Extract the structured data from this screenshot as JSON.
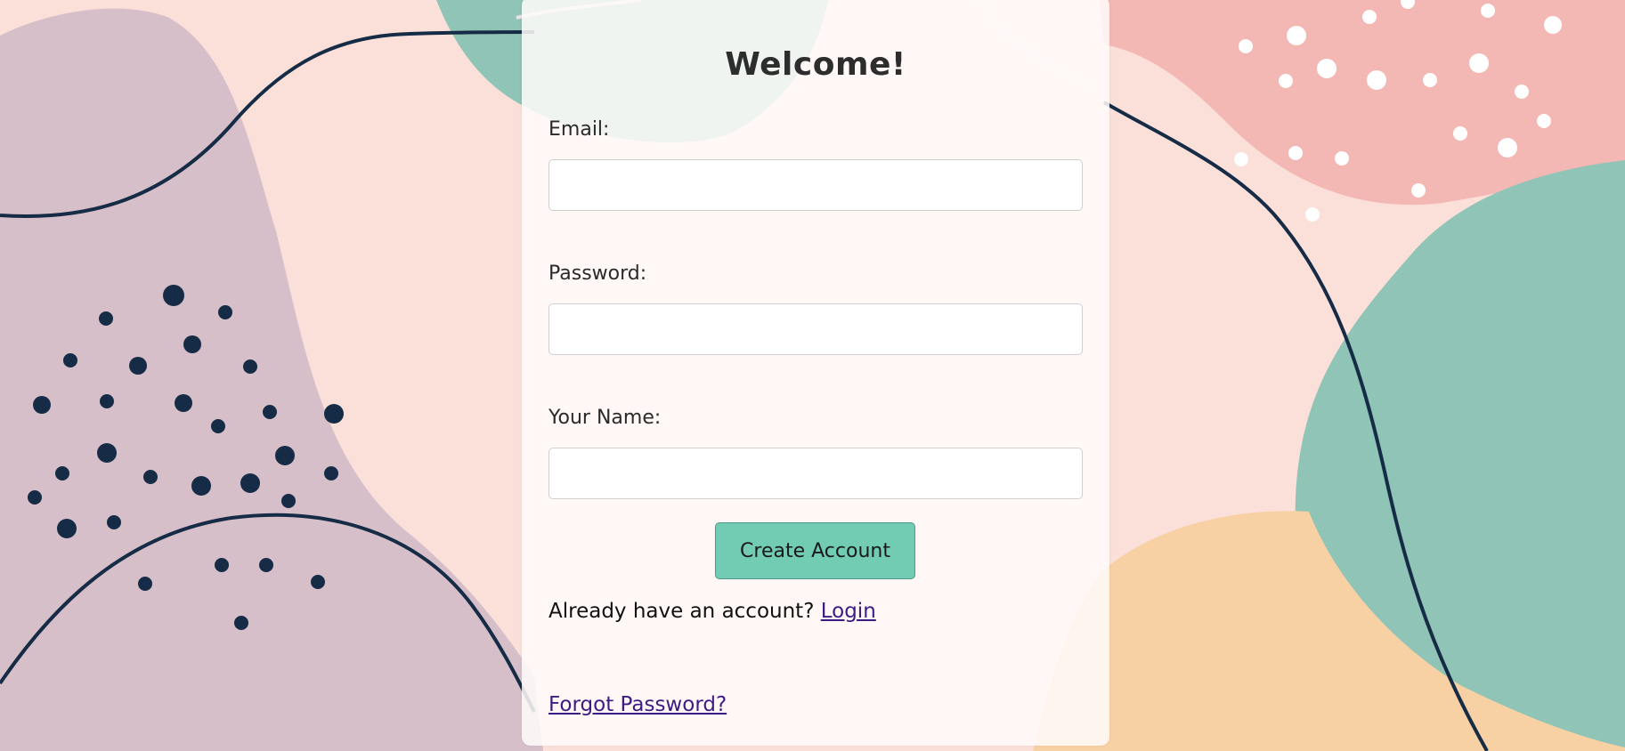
{
  "page": {
    "heading": "Welcome!"
  },
  "form": {
    "email_label": "Email:",
    "email_value": "",
    "password_label": "Password:",
    "password_value": "",
    "name_label": "Your Name:",
    "name_value": "",
    "submit_label": "Create Account"
  },
  "footer": {
    "login_prompt": "Already have an account?",
    "login_link": "Login",
    "forgot_link": "Forgot Password?"
  },
  "colors": {
    "background_peach": "#fbe0d9",
    "blob_mauve": "#d6bfc9",
    "blob_teal": "#8fc4b6",
    "blob_pink": "#f3b8b4",
    "blob_orange": "#f7d1a4",
    "dots_navy": "#162c46",
    "button_green": "#72cbb3",
    "link_purple": "#3c1b84"
  }
}
